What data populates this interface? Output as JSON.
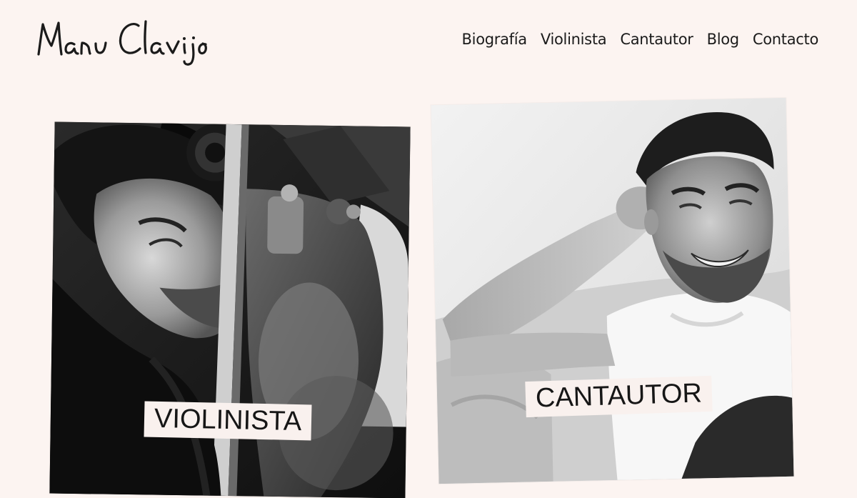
{
  "header": {
    "logo_text": "Manu Clavijo",
    "nav": [
      {
        "label": "Biografía"
      },
      {
        "label": "Violinista"
      },
      {
        "label": "Cantautor"
      },
      {
        "label": "Blog"
      },
      {
        "label": "Contacto"
      }
    ]
  },
  "cards": [
    {
      "label": "VIOLINISTA",
      "photo": "violinist-photo"
    },
    {
      "label": "CANTAUTOR",
      "photo": "singer-photo"
    }
  ],
  "colors": {
    "background": "#fcf4f1",
    "text": "#1b1b1b",
    "label_bg": "#f9f1ee"
  }
}
